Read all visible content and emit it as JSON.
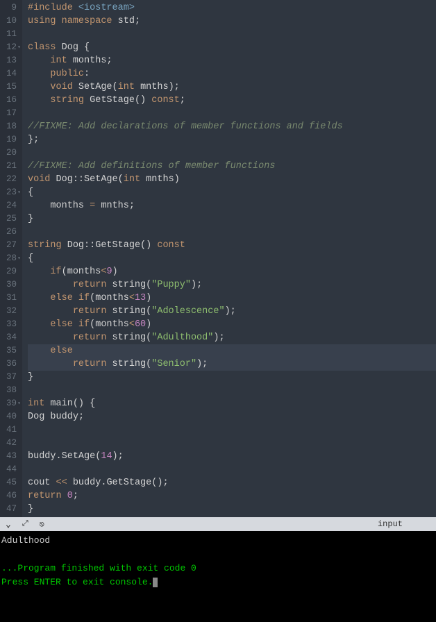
{
  "lineStart": 9,
  "lineEnd": 47,
  "foldLines": [
    12,
    23,
    28,
    39
  ],
  "highlightLines": [
    35,
    36
  ],
  "rows": [
    {
      "n": 9,
      "seg": [
        [
          "tok-preproc",
          "#include "
        ],
        [
          "tok-include",
          "<iostream>"
        ]
      ]
    },
    {
      "n": 10,
      "seg": [
        [
          "tok-keyword",
          "using"
        ],
        [
          "tok-punct",
          " "
        ],
        [
          "tok-keyword",
          "namespace"
        ],
        [
          "tok-punct",
          " "
        ],
        [
          "tok-ident",
          "std"
        ],
        [
          "tok-punct",
          ";"
        ]
      ]
    },
    {
      "n": 11,
      "seg": []
    },
    {
      "n": 12,
      "seg": [
        [
          "tok-keyword",
          "class"
        ],
        [
          "tok-punct",
          " "
        ],
        [
          "tok-ident",
          "Dog"
        ],
        [
          "tok-punct",
          " {"
        ]
      ]
    },
    {
      "n": 13,
      "seg": [
        [
          "tok-punct",
          "    "
        ],
        [
          "tok-type",
          "int"
        ],
        [
          "tok-punct",
          " "
        ],
        [
          "tok-ident",
          "months"
        ],
        [
          "tok-punct",
          ";"
        ]
      ]
    },
    {
      "n": 14,
      "seg": [
        [
          "tok-punct",
          "    "
        ],
        [
          "tok-keyword",
          "public"
        ],
        [
          "tok-punct",
          ":"
        ]
      ]
    },
    {
      "n": 15,
      "seg": [
        [
          "tok-punct",
          "    "
        ],
        [
          "tok-type",
          "void"
        ],
        [
          "tok-punct",
          " "
        ],
        [
          "tok-func",
          "SetAge"
        ],
        [
          "tok-punct",
          "("
        ],
        [
          "tok-type",
          "int"
        ],
        [
          "tok-punct",
          " "
        ],
        [
          "tok-ident",
          "mnths"
        ],
        [
          "tok-punct",
          ");"
        ]
      ]
    },
    {
      "n": 16,
      "seg": [
        [
          "tok-punct",
          "    "
        ],
        [
          "tok-type",
          "string"
        ],
        [
          "tok-punct",
          " "
        ],
        [
          "tok-func",
          "GetStage"
        ],
        [
          "tok-punct",
          "() "
        ],
        [
          "tok-keyword",
          "const"
        ],
        [
          "tok-punct",
          ";"
        ]
      ]
    },
    {
      "n": 17,
      "seg": []
    },
    {
      "n": 18,
      "seg": [
        [
          "tok-comment",
          "//FIXME: Add declarations of member functions and fields"
        ]
      ]
    },
    {
      "n": 19,
      "seg": [
        [
          "tok-punct",
          "};"
        ]
      ]
    },
    {
      "n": 20,
      "seg": []
    },
    {
      "n": 21,
      "seg": [
        [
          "tok-comment",
          "//FIXME: Add definitions of member functions"
        ]
      ]
    },
    {
      "n": 22,
      "seg": [
        [
          "tok-type",
          "void"
        ],
        [
          "tok-punct",
          " "
        ],
        [
          "tok-ident",
          "Dog"
        ],
        [
          "tok-punct",
          "::"
        ],
        [
          "tok-func",
          "SetAge"
        ],
        [
          "tok-punct",
          "("
        ],
        [
          "tok-type",
          "int"
        ],
        [
          "tok-punct",
          " "
        ],
        [
          "tok-ident",
          "mnths"
        ],
        [
          "tok-punct",
          ")"
        ]
      ]
    },
    {
      "n": 23,
      "seg": [
        [
          "tok-punct",
          "{"
        ]
      ]
    },
    {
      "n": 24,
      "seg": [
        [
          "tok-punct",
          "    "
        ],
        [
          "tok-ident",
          "months"
        ],
        [
          "tok-punct",
          " "
        ],
        [
          "tok-op",
          "="
        ],
        [
          "tok-punct",
          " "
        ],
        [
          "tok-ident",
          "mnths"
        ],
        [
          "tok-punct",
          ";"
        ]
      ]
    },
    {
      "n": 25,
      "seg": [
        [
          "tok-punct",
          "}"
        ]
      ]
    },
    {
      "n": 26,
      "seg": []
    },
    {
      "n": 27,
      "seg": [
        [
          "tok-type",
          "string"
        ],
        [
          "tok-punct",
          " "
        ],
        [
          "tok-ident",
          "Dog"
        ],
        [
          "tok-punct",
          "::"
        ],
        [
          "tok-func",
          "GetStage"
        ],
        [
          "tok-punct",
          "() "
        ],
        [
          "tok-keyword",
          "const"
        ]
      ]
    },
    {
      "n": 28,
      "seg": [
        [
          "tok-punct",
          "{"
        ]
      ]
    },
    {
      "n": 29,
      "seg": [
        [
          "tok-punct",
          "    "
        ],
        [
          "tok-keyword",
          "if"
        ],
        [
          "tok-punct",
          "("
        ],
        [
          "tok-ident",
          "months"
        ],
        [
          "tok-op",
          "<"
        ],
        [
          "tok-num",
          "9"
        ],
        [
          "tok-punct",
          ")"
        ]
      ]
    },
    {
      "n": 30,
      "seg": [
        [
          "tok-punct",
          "        "
        ],
        [
          "tok-keyword",
          "return"
        ],
        [
          "tok-punct",
          " "
        ],
        [
          "tok-ident",
          "string"
        ],
        [
          "tok-punct",
          "("
        ],
        [
          "tok-string",
          "\"Puppy\""
        ],
        [
          "tok-punct",
          ");"
        ]
      ]
    },
    {
      "n": 31,
      "seg": [
        [
          "tok-punct",
          "    "
        ],
        [
          "tok-keyword",
          "else"
        ],
        [
          "tok-punct",
          " "
        ],
        [
          "tok-keyword",
          "if"
        ],
        [
          "tok-punct",
          "("
        ],
        [
          "tok-ident",
          "months"
        ],
        [
          "tok-op",
          "<"
        ],
        [
          "tok-num",
          "13"
        ],
        [
          "tok-punct",
          ")"
        ]
      ]
    },
    {
      "n": 32,
      "seg": [
        [
          "tok-punct",
          "        "
        ],
        [
          "tok-keyword",
          "return"
        ],
        [
          "tok-punct",
          " "
        ],
        [
          "tok-ident",
          "string"
        ],
        [
          "tok-punct",
          "("
        ],
        [
          "tok-string",
          "\"Adolescence\""
        ],
        [
          "tok-punct",
          ");"
        ]
      ]
    },
    {
      "n": 33,
      "seg": [
        [
          "tok-punct",
          "    "
        ],
        [
          "tok-keyword",
          "else"
        ],
        [
          "tok-punct",
          " "
        ],
        [
          "tok-keyword",
          "if"
        ],
        [
          "tok-punct",
          "("
        ],
        [
          "tok-ident",
          "months"
        ],
        [
          "tok-op",
          "<"
        ],
        [
          "tok-num",
          "60"
        ],
        [
          "tok-punct",
          ")"
        ]
      ]
    },
    {
      "n": 34,
      "seg": [
        [
          "tok-punct",
          "        "
        ],
        [
          "tok-keyword",
          "return"
        ],
        [
          "tok-punct",
          " "
        ],
        [
          "tok-ident",
          "string"
        ],
        [
          "tok-punct",
          "("
        ],
        [
          "tok-string",
          "\"Adulthood\""
        ],
        [
          "tok-punct",
          ");"
        ]
      ]
    },
    {
      "n": 35,
      "seg": [
        [
          "tok-punct",
          "    "
        ],
        [
          "tok-keyword",
          "else"
        ],
        [
          "tok-punct",
          " "
        ]
      ]
    },
    {
      "n": 36,
      "seg": [
        [
          "tok-punct",
          "        "
        ],
        [
          "tok-keyword",
          "return"
        ],
        [
          "tok-punct",
          " "
        ],
        [
          "tok-ident",
          "string"
        ],
        [
          "tok-punct",
          "("
        ],
        [
          "tok-string",
          "\"Senior\""
        ],
        [
          "tok-punct",
          ");"
        ]
      ]
    },
    {
      "n": 37,
      "seg": [
        [
          "tok-punct",
          "}"
        ]
      ]
    },
    {
      "n": 38,
      "seg": []
    },
    {
      "n": 39,
      "seg": [
        [
          "tok-type",
          "int"
        ],
        [
          "tok-punct",
          " "
        ],
        [
          "tok-func",
          "main"
        ],
        [
          "tok-punct",
          "() {"
        ]
      ]
    },
    {
      "n": 40,
      "seg": [
        [
          "tok-ident",
          "Dog"
        ],
        [
          "tok-punct",
          " "
        ],
        [
          "tok-ident",
          "buddy"
        ],
        [
          "tok-punct",
          ";"
        ]
      ]
    },
    {
      "n": 41,
      "seg": []
    },
    {
      "n": 42,
      "seg": []
    },
    {
      "n": 43,
      "seg": [
        [
          "tok-ident",
          "buddy"
        ],
        [
          "tok-punct",
          "."
        ],
        [
          "tok-func",
          "SetAge"
        ],
        [
          "tok-punct",
          "("
        ],
        [
          "tok-num",
          "14"
        ],
        [
          "tok-punct",
          ");"
        ]
      ]
    },
    {
      "n": 44,
      "seg": []
    },
    {
      "n": 45,
      "seg": [
        [
          "tok-ident",
          "cout"
        ],
        [
          "tok-punct",
          " "
        ],
        [
          "tok-op",
          "<<"
        ],
        [
          "tok-punct",
          " "
        ],
        [
          "tok-ident",
          "buddy"
        ],
        [
          "tok-punct",
          "."
        ],
        [
          "tok-func",
          "GetStage"
        ],
        [
          "tok-punct",
          "();"
        ]
      ]
    },
    {
      "n": 46,
      "seg": [
        [
          "tok-keyword",
          "return"
        ],
        [
          "tok-punct",
          " "
        ],
        [
          "tok-ret0",
          "0"
        ],
        [
          "tok-punct",
          ";"
        ]
      ]
    },
    {
      "n": 47,
      "seg": [
        [
          "tok-punct",
          "}"
        ]
      ]
    }
  ],
  "toolbar": {
    "input_label": "input"
  },
  "console": {
    "line1": "Adulthood",
    "line2": "",
    "line3": "...Program finished with exit code 0",
    "line4": "Press ENTER to exit console."
  }
}
